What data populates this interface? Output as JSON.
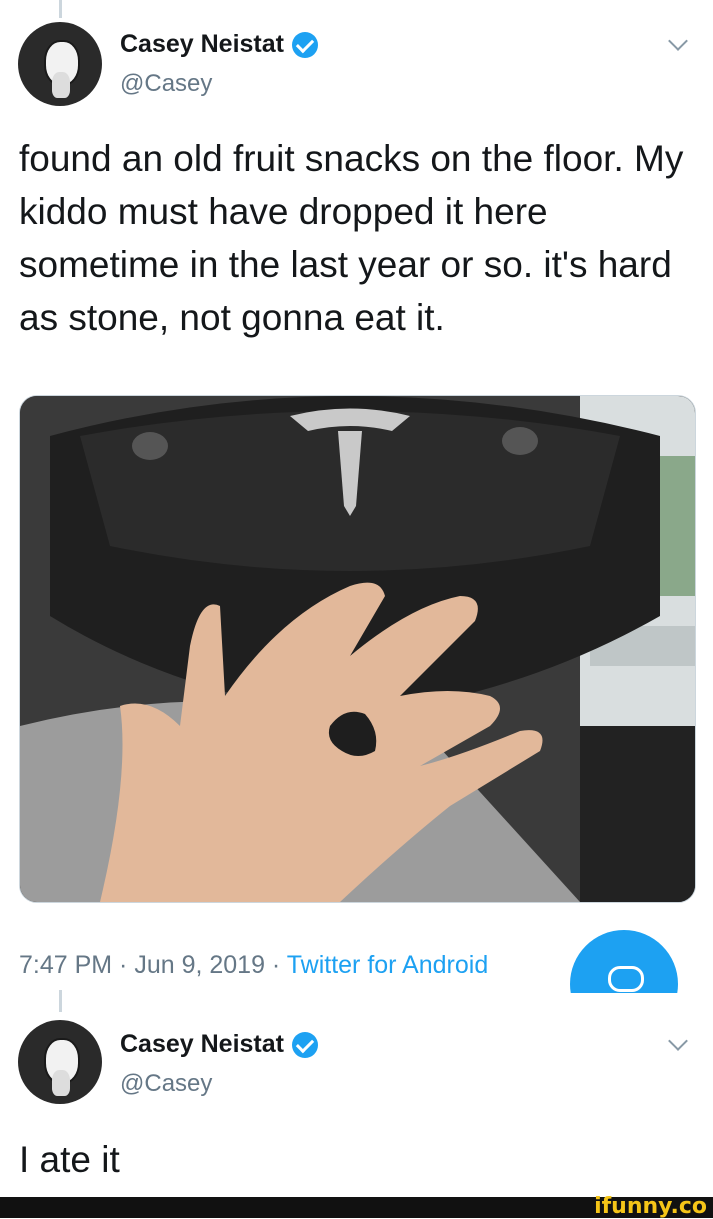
{
  "tweet1": {
    "name": "Casey Neistat",
    "handle": "@Casey",
    "text": "found an old fruit snacks on the floor. My kiddo must have dropped it here sometime in the last year or so. it's hard as stone, not gonna eat it.",
    "timestamp": "7:47 PM · Jun 9, 2019 · ",
    "source": "Twitter for Android"
  },
  "tweet2": {
    "name": "Casey Neistat",
    "handle": "@Casey",
    "text": "I ate it"
  },
  "watermark": "ifunny.co",
  "colors": {
    "accent": "#1da1f2",
    "text": "#14171a",
    "muted": "#657786"
  },
  "icons": [
    "verified-icon",
    "chevron-down-icon",
    "compose-icon"
  ]
}
